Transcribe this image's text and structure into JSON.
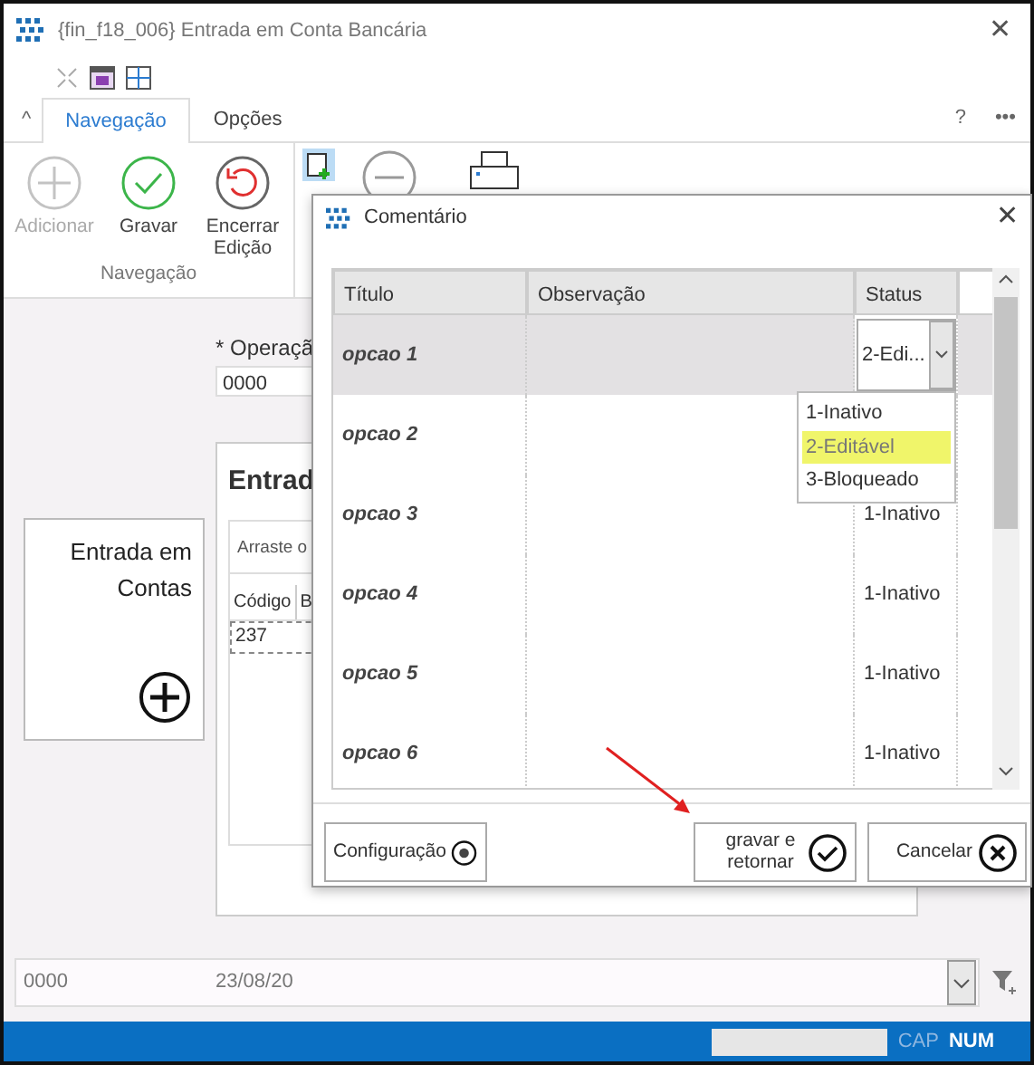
{
  "window": {
    "title": "{fin_f18_006}  Entrada em Conta Bancária",
    "close": "✕"
  },
  "ribbon": {
    "collapse": "^",
    "tabs": [
      {
        "label": "Navegação",
        "selected": true
      },
      {
        "label": "Opções",
        "selected": false
      }
    ],
    "help": "?",
    "more": "•••",
    "buttons": [
      {
        "label": "Adicionar",
        "kind": "add",
        "disabled": true
      },
      {
        "label": "Gravar",
        "kind": "save",
        "disabled": false
      },
      {
        "label": "Encerrar Edição",
        "kind": "undo",
        "disabled": false
      }
    ],
    "group_label": "Navegação"
  },
  "form": {
    "operation_label": "* Operaçã",
    "operation_value": "0000"
  },
  "side_card": {
    "title": "Entrada em Contas"
  },
  "panel": {
    "heading": "Entrad",
    "group_hint": "Arraste o",
    "columns": [
      "Código",
      "B"
    ],
    "cell": "237"
  },
  "filter_bar": {
    "values": [
      "0000",
      "23/08/20"
    ]
  },
  "status_bar": {
    "indicators": [
      {
        "label": "CAP",
        "on": false
      },
      {
        "label": "NUM",
        "on": true
      }
    ]
  },
  "dialog": {
    "title": "Comentário",
    "close": "✕",
    "columns": [
      "Título",
      "Observação",
      "Status"
    ],
    "rows": [
      {
        "title": "opcao 1",
        "status": "2-Edi...",
        "selected": true,
        "editing": true
      },
      {
        "title": "opcao 2",
        "selected": false,
        "editing": false
      },
      {
        "title": "opcao 3",
        "status": "1-Inativo",
        "selected": false,
        "editing": false
      },
      {
        "title": "opcao 4",
        "status": "1-Inativo",
        "selected": false,
        "editing": false
      },
      {
        "title": "opcao 5",
        "status": "1-Inativo",
        "selected": false,
        "editing": false
      },
      {
        "title": "opcao 6",
        "status": "1-Inativo",
        "selected": false,
        "editing": false
      }
    ],
    "status_options": [
      {
        "label": "1-Inativo",
        "selected": false
      },
      {
        "label": "2-Editável",
        "selected": true
      },
      {
        "label": "3-Bloqueado",
        "selected": false
      }
    ],
    "buttons": [
      {
        "label": "Configuração",
        "kind": "settings"
      },
      {
        "label": "gravar e retornar",
        "kind": "confirm"
      },
      {
        "label": "Cancelar",
        "kind": "cancel"
      }
    ]
  }
}
